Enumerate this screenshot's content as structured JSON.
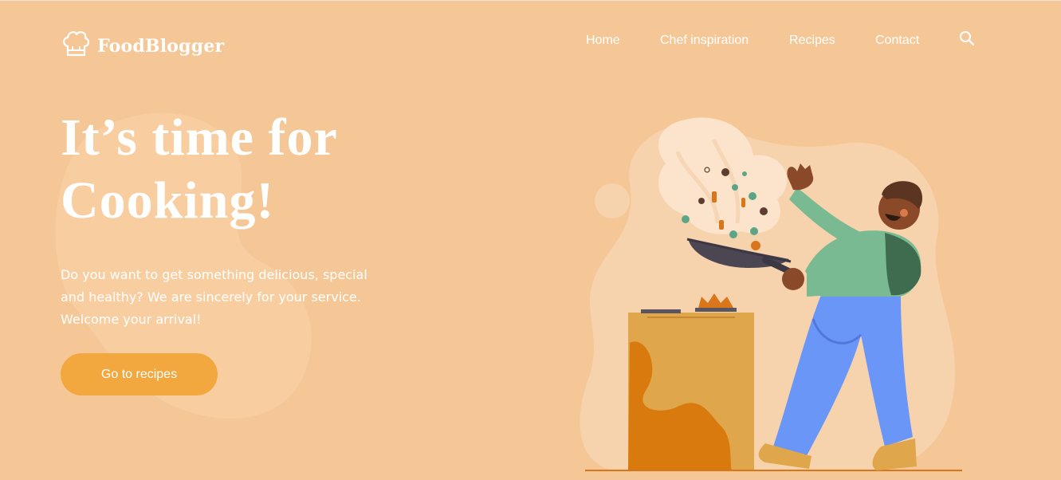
{
  "brand": {
    "name": "FoodBlogger",
    "logo_icon": "chef-hat-icon"
  },
  "nav": {
    "items": [
      {
        "label": "Home"
      },
      {
        "label": "Chef inspiration"
      },
      {
        "label": "Recipes"
      },
      {
        "label": "Contact"
      }
    ],
    "search_icon": "search-icon"
  },
  "hero": {
    "title_line1": "It’s time for",
    "title_line2": "Cooking!",
    "description_line1": "Do you want to get something delicious, special",
    "description_line2": "and healthy? We are sincerely for your service.",
    "description_line3": "Welcome your arrival!",
    "cta_label": "Go to recipes"
  },
  "colors": {
    "background": "#f5c796",
    "accent": "#f2a73f",
    "text": "#ffffff"
  }
}
